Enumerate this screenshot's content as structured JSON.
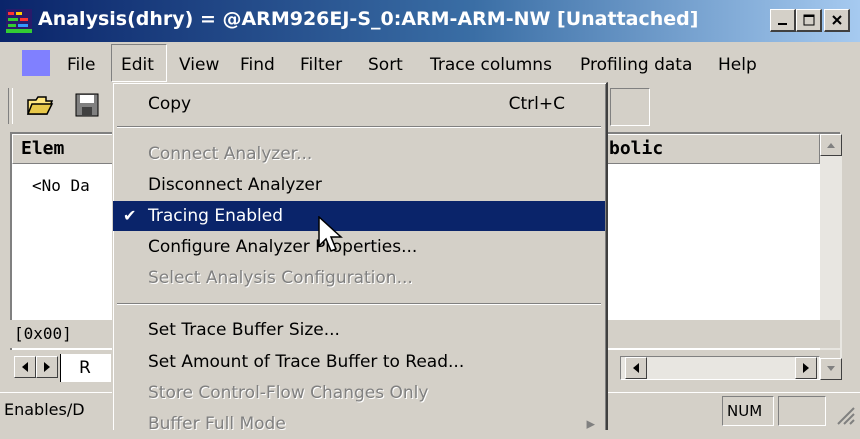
{
  "window": {
    "title": "Analysis(dhry) = @ARM926EJ-S_0:ARM-ARM-NW [Unattached]",
    "controls": [
      "minimize",
      "maximize",
      "close"
    ]
  },
  "menubar": {
    "items": [
      "File",
      "Edit",
      "View",
      "Find",
      "Filter",
      "Sort",
      "Trace columns",
      "Profiling data",
      "Help"
    ],
    "open_menu": "Edit"
  },
  "columns": {
    "element": "Elem",
    "symbolic": "bolic"
  },
  "list": {
    "empty_text": "<No Da"
  },
  "address_field": "[0x00]",
  "tab_label": "R",
  "status": {
    "left_text": "Enables/D",
    "num_indicator": "NUM"
  },
  "edit_menu": {
    "items": [
      {
        "label": "Copy",
        "shortcut": "Ctrl+C",
        "enabled": true
      },
      {
        "label": "Connect Analyzer...",
        "enabled": false
      },
      {
        "label": "Disconnect Analyzer",
        "enabled": true
      },
      {
        "label": "Tracing Enabled",
        "enabled": true,
        "checked": true,
        "highlighted": true
      },
      {
        "label": "Configure Analyzer Properties...",
        "enabled": true
      },
      {
        "label": "Select Analysis Configuration...",
        "enabled": false
      },
      {
        "label": "Set Trace Buffer Size...",
        "enabled": true
      },
      {
        "label": "Set Amount of Trace Buffer to Read...",
        "enabled": true
      },
      {
        "label": "Store Control-Flow Changes Only",
        "enabled": false
      },
      {
        "label": "Buffer Full Mode",
        "enabled": false,
        "submenu": true
      }
    ],
    "check_glyph": "✔",
    "submenu_glyph": "▸"
  },
  "colors": {
    "highlight": "#0a246a",
    "title_gradient_start": "#0a246a",
    "title_gradient_end": "#a6caf0",
    "face": "#d4d0c8"
  }
}
